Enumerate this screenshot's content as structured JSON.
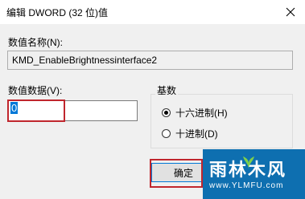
{
  "dialog": {
    "title": "编辑 DWORD (32 位)值",
    "value_name_label": "数值名称(N):",
    "value_name": "KMD_EnableBrightnessinterface2",
    "value_data_label": "数值数据(V):",
    "value_data": "0",
    "base": {
      "label": "基数",
      "options": [
        {
          "label": "十六进制(H)",
          "selected": true
        },
        {
          "label": "十进制(D)",
          "selected": false
        }
      ]
    },
    "ok_label": "确定"
  },
  "watermark": {
    "main": "雨林木风",
    "sub": "www.YLMFU.com"
  },
  "colors": {
    "highlight": "#c0262d",
    "selection": "#0078d7",
    "watermark_bg": "#0e6fb0"
  },
  "icons": {
    "close": "close-icon",
    "radio": "radio-icon"
  }
}
